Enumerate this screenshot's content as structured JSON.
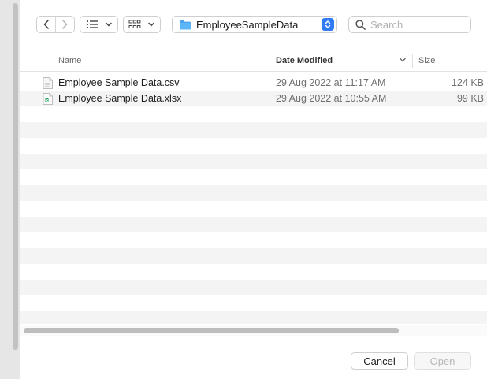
{
  "toolbar": {
    "back_icon": "chevron-left",
    "forward_icon": "chevron-right",
    "view_list_icon": "list-view",
    "view_grid_icon": "grid-view",
    "folder_name": "EmployeeSampleData",
    "search_placeholder": "Search"
  },
  "columns": {
    "name": "Name",
    "date": "Date Modified",
    "size": "Size"
  },
  "files": [
    {
      "name": "Employee Sample Data.csv",
      "date": "29 Aug 2022 at 11:17 AM",
      "size": "124 KB",
      "icon": "csv-document-icon"
    },
    {
      "name": "Employee Sample Data.xlsx",
      "date": "29 Aug 2022 at 10:55 AM",
      "size": "99 KB",
      "icon": "excel-document-icon"
    }
  ],
  "footer": {
    "cancel_label": "Cancel",
    "open_label": "Open"
  },
  "colors": {
    "accent": "#2f7bf5",
    "folder": "#4aa6f0",
    "row_alt": "#f4f4f5"
  }
}
